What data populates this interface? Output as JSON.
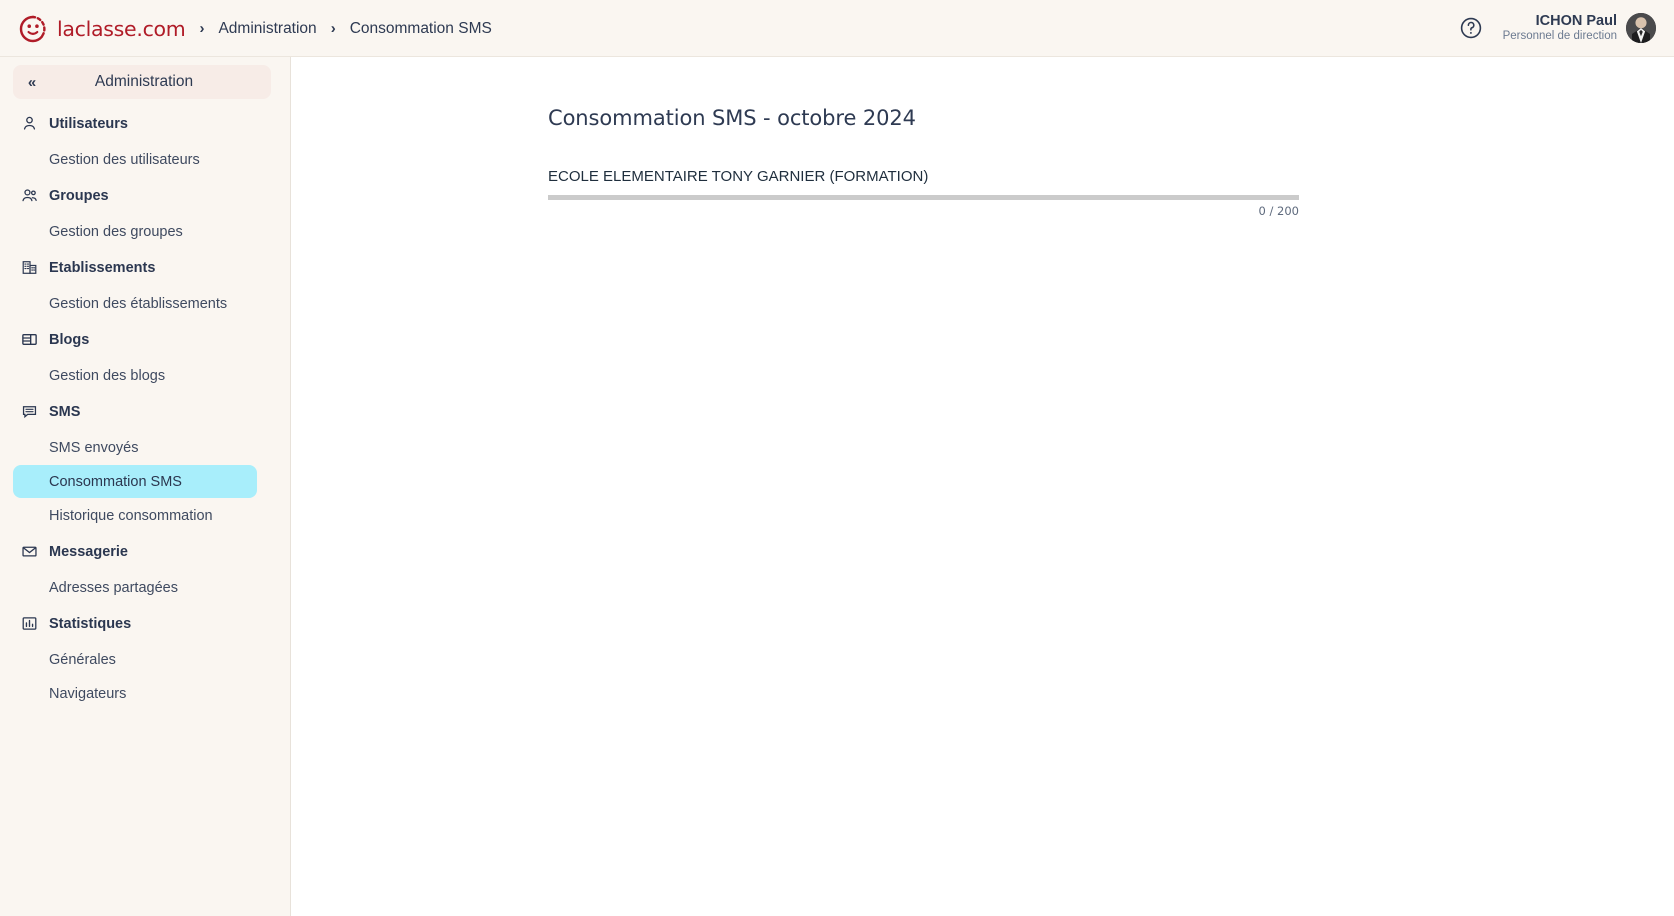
{
  "topbar": {
    "brand_name": "laclasse.com",
    "brand_color": "#b01c28",
    "breadcrumb": [
      {
        "label": "Administration",
        "current": false
      },
      {
        "label": "Consommation SMS",
        "current": true
      }
    ],
    "separator": "›",
    "help_icon": "help-circle-icon",
    "user": {
      "name": "ICHON Paul",
      "role": "Personnel de direction",
      "avatar_icon": "user-avatar-photo"
    }
  },
  "sidebar": {
    "title": "Administration",
    "collapse_icon": "«",
    "groups": [
      {
        "label": "Utilisateurs",
        "icon": "user-icon",
        "children": [
          {
            "label": "Gestion des utilisateurs",
            "active": false
          }
        ]
      },
      {
        "label": "Groupes",
        "icon": "users-group-icon",
        "children": [
          {
            "label": "Gestion des groupes",
            "active": false
          }
        ]
      },
      {
        "label": "Etablissements",
        "icon": "building-icon",
        "children": [
          {
            "label": "Gestion des établissements",
            "active": false
          }
        ]
      },
      {
        "label": "Blogs",
        "icon": "layout-panel-icon",
        "children": [
          {
            "label": "Gestion des blogs",
            "active": false
          }
        ]
      },
      {
        "label": "SMS",
        "icon": "message-lines-icon",
        "children": [
          {
            "label": "SMS envoyés",
            "active": false
          },
          {
            "label": "Consommation SMS",
            "active": true
          },
          {
            "label": "Historique consommation",
            "active": false
          }
        ]
      },
      {
        "label": "Messagerie",
        "icon": "envelope-icon",
        "children": [
          {
            "label": "Adresses partagées",
            "active": false
          }
        ]
      },
      {
        "label": "Statistiques",
        "icon": "bar-chart-icon",
        "children": [
          {
            "label": "Générales",
            "active": false
          },
          {
            "label": "Navigateurs",
            "active": false
          }
        ]
      }
    ],
    "active_item": "Consommation SMS",
    "active_bg": "#a8eefb",
    "background": "#faf6f1"
  },
  "main": {
    "page_title": "Consommation SMS - octobre 2024",
    "establishments": [
      {
        "name": "ECOLE ELEMENTAIRE TONY GARNIER (FORMATION)",
        "used": 0,
        "quota": 200,
        "caption": "0 / 200",
        "percent": 0,
        "track_color": "#cbcbcb",
        "fill_color": "#3f8fd0"
      }
    ]
  }
}
